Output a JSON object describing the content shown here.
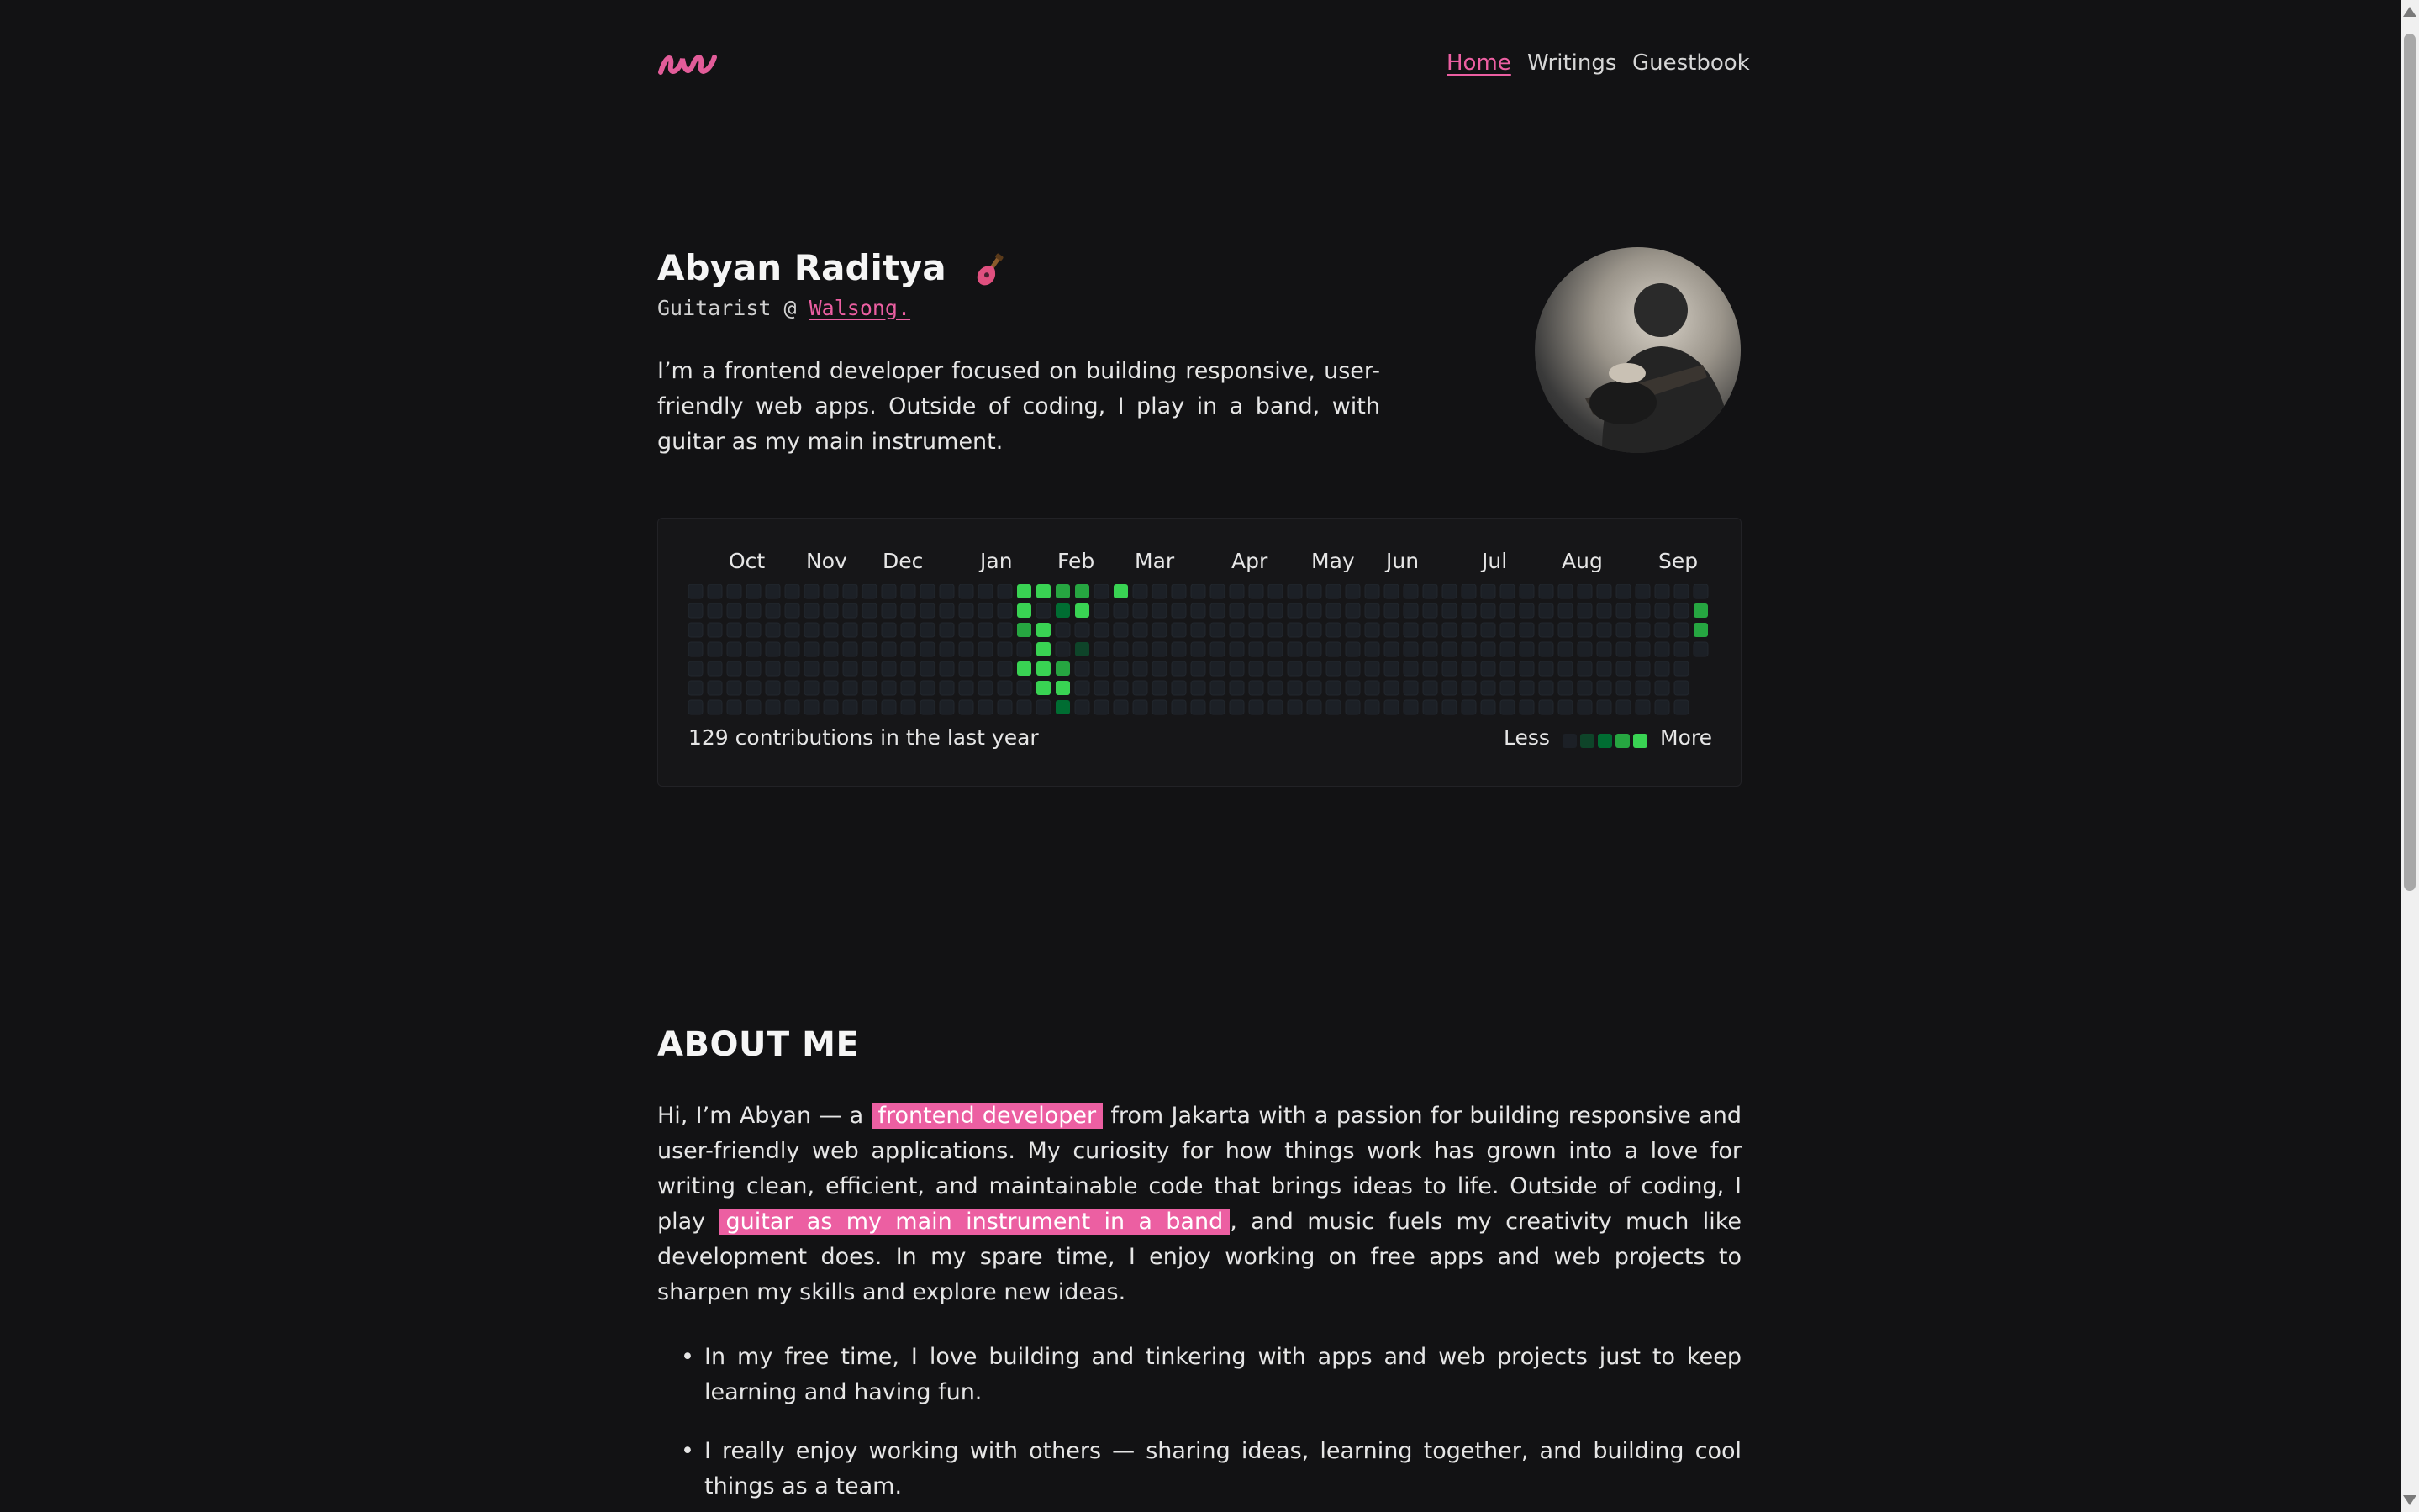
{
  "nav": {
    "links": [
      {
        "label": "Home",
        "active": true
      },
      {
        "label": "Writings",
        "active": false
      },
      {
        "label": "Guestbook",
        "active": false
      }
    ]
  },
  "hero": {
    "name": "Abyan Raditya",
    "role_prefix": "Guitarist @ ",
    "role_link": "Walsong.",
    "intro": "I’m a frontend developer focused on building responsive, user-friendly web apps. Outside of coding, I play in a band, with guitar as my main instrument."
  },
  "contributions": {
    "months": [
      "Oct",
      "Nov",
      "Dec",
      "Jan",
      "Feb",
      "Mar",
      "Apr",
      "May",
      "Jun",
      "Jul",
      "Aug",
      "Sep"
    ],
    "summary": "129 contributions in the last year",
    "legend_less": "Less",
    "legend_more": "More",
    "colors": [
      "#1c2026",
      "#0e4429",
      "#006d32",
      "#26a641",
      "#39d353"
    ]
  },
  "about": {
    "title": "ABOUT ME",
    "p1_a": "Hi, I’m Abyan — a ",
    "p1_hl1": "frontend developer",
    "p1_b": " from Jakarta with a passion for building responsive and user-friendly web applications. My curiosity for how things work has grown into a love for writing clean, efficient, and maintainable code that brings ideas to life. Outside of coding, I play ",
    "p1_hl2": "guitar as my main instrument in a band",
    "p1_c": ", and music fuels my creativity much like development does. In my spare time, I enjoy working on free apps and web projects to sharpen my skills and explore new ideas.",
    "bullets": [
      "In my free time, I love building and tinkering with apps and web projects just to keep learning and having fun.",
      "I really enjoy working with others — sharing ideas, learning together, and building cool things as a team."
    ]
  },
  "colors": {
    "background": "#121214",
    "accent": "#ec5fa2"
  }
}
